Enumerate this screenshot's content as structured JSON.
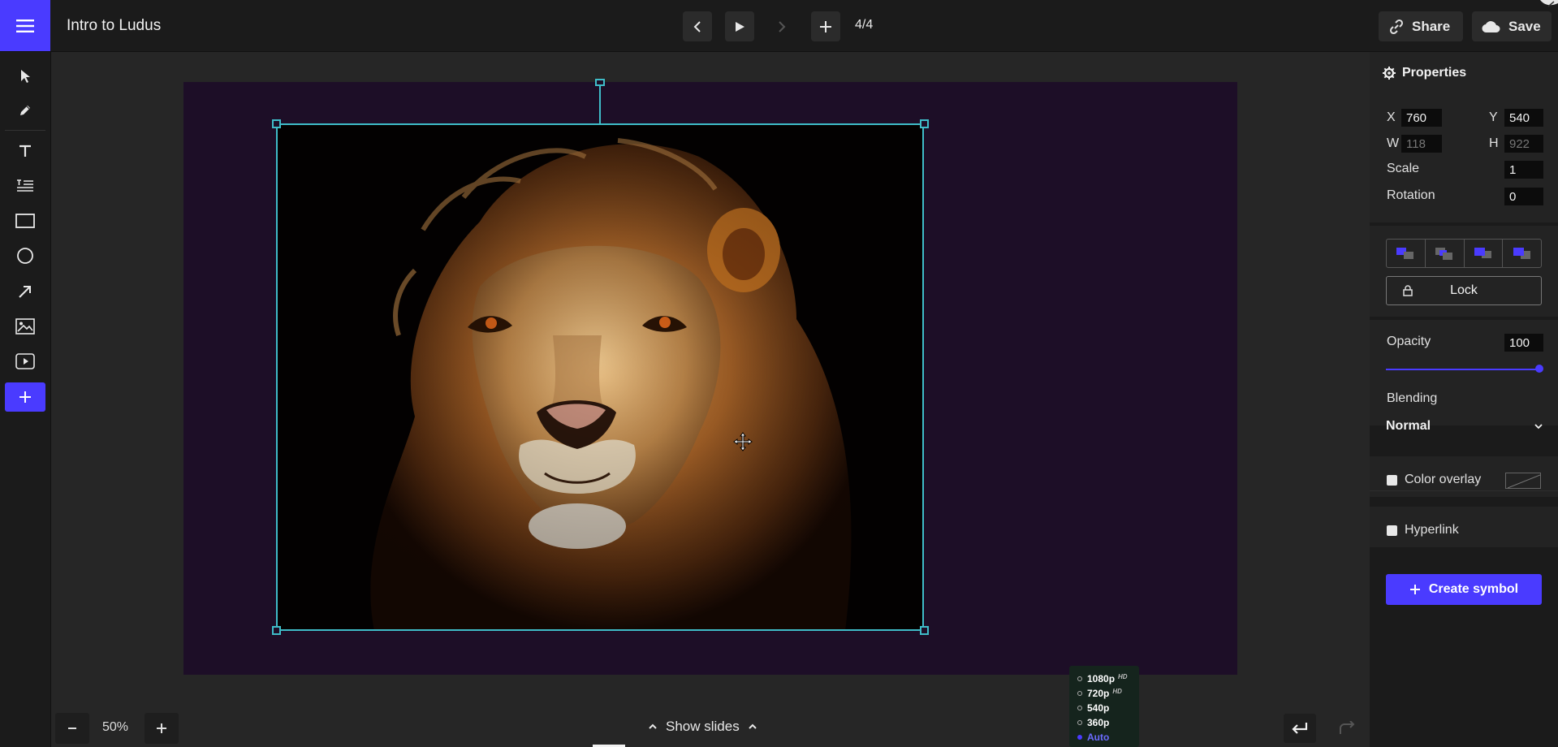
{
  "header": {
    "title": "Intro to Ludus",
    "slide_counter": "4/4",
    "share_label": "Share",
    "save_label": "Save"
  },
  "toolbar": {
    "tools": [
      "pointer-icon",
      "pen-icon",
      "text-icon",
      "paragraph-icon",
      "rectangle-icon",
      "ellipse-icon",
      "arrow-icon",
      "image-icon",
      "video-icon",
      "plus-icon"
    ]
  },
  "canvas": {
    "slide_background": "#1d0e27",
    "selection_color": "#3fbcc8"
  },
  "bottom": {
    "zoom": "50%",
    "show_slides_label": "Show slides",
    "quality_options": [
      {
        "label": "1080p",
        "hd": "HD",
        "selected": false
      },
      {
        "label": "720p",
        "hd": "HD",
        "selected": false
      },
      {
        "label": "540p",
        "hd": "",
        "selected": false
      },
      {
        "label": "360p",
        "hd": "",
        "selected": false
      },
      {
        "label": "Auto",
        "hd": "",
        "selected": true
      }
    ]
  },
  "properties": {
    "title": "Properties",
    "x_label": "X",
    "x_value": "760",
    "y_label": "Y",
    "y_value": "540",
    "w_label": "W",
    "w_value": "118",
    "h_label": "H",
    "h_value": "922",
    "scale_label": "Scale",
    "scale_value": "1",
    "rotation_label": "Rotation",
    "rotation_value": "0",
    "lock_label": "Lock",
    "opacity_label": "Opacity",
    "opacity_value": "100",
    "opacity_fraction": 1.0,
    "blending_label": "Blending",
    "blending_value": "Normal",
    "color_overlay_label": "Color overlay",
    "hyperlink_label": "Hyperlink",
    "create_symbol_label": "Create symbol"
  },
  "colors": {
    "accent": "#4a3bff",
    "selection": "#3fbcc8"
  }
}
